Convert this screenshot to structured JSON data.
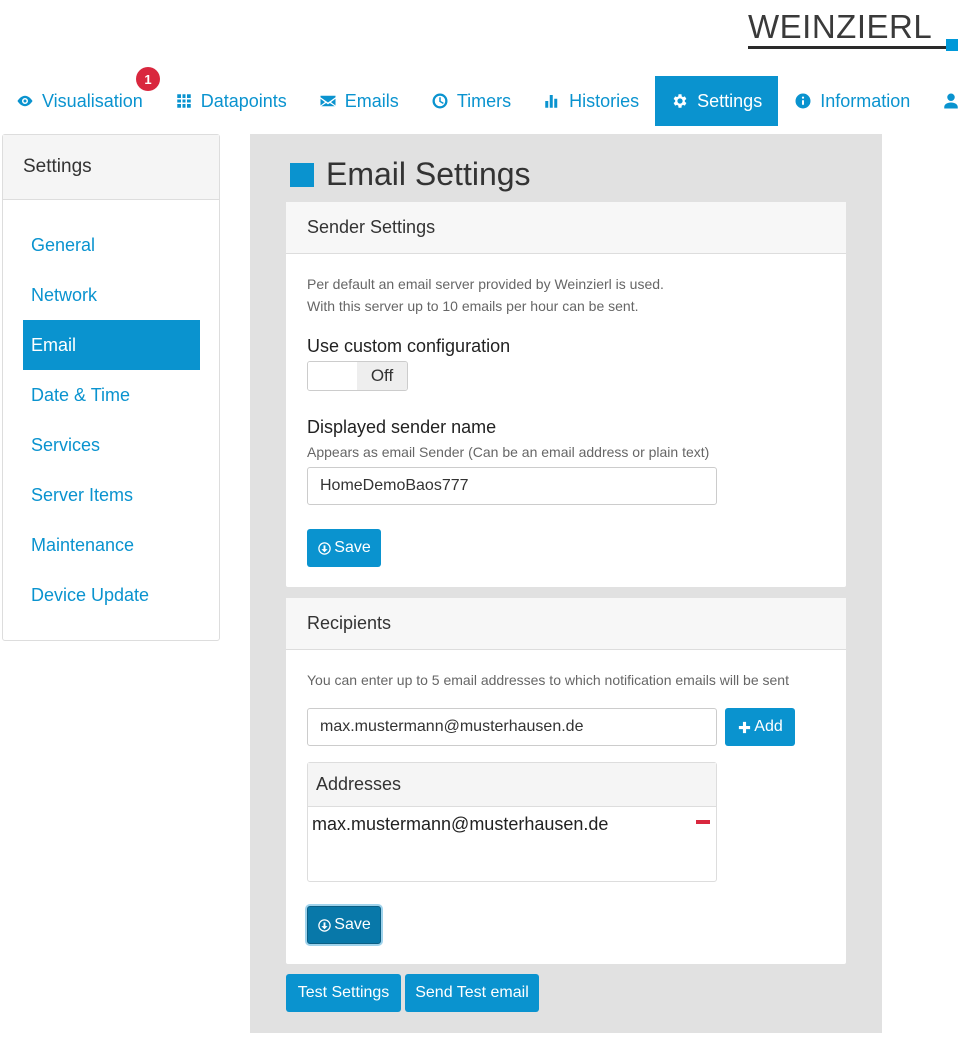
{
  "brand": {
    "logo_text": "WEINZIERL",
    "accent": "#0a93cf"
  },
  "nav": {
    "items": [
      {
        "label": "Visualisation",
        "icon": "eye-icon",
        "badge": "1"
      },
      {
        "label": "Datapoints",
        "icon": "grid-icon"
      },
      {
        "label": "Emails",
        "icon": "envelope-icon"
      },
      {
        "label": "Timers",
        "icon": "clock-icon"
      },
      {
        "label": "Histories",
        "icon": "bar-chart-icon"
      },
      {
        "label": "Settings",
        "icon": "gear-icon",
        "active": true
      },
      {
        "label": "Information",
        "icon": "info-icon"
      }
    ],
    "user_icon": "user-icon"
  },
  "sidebar": {
    "title": "Settings",
    "items": [
      {
        "label": "General"
      },
      {
        "label": "Network"
      },
      {
        "label": "Email",
        "active": true
      },
      {
        "label": "Date & Time"
      },
      {
        "label": "Services"
      },
      {
        "label": "Server Items"
      },
      {
        "label": "Maintenance"
      },
      {
        "label": "Device Update"
      }
    ]
  },
  "main": {
    "title": "Email Settings",
    "sender": {
      "heading": "Sender Settings",
      "info_line1": "Per default an email server provided by Weinzierl is used.",
      "info_line2": "With this server up to 10 emails per hour can be sent.",
      "custom_config_label": "Use custom configuration",
      "custom_config_state": "Off",
      "sender_name_label": "Displayed sender name",
      "sender_name_help": "Appears as email Sender (Can be an email address or plain text)",
      "sender_name_value": "HomeDemoBaos777",
      "save_label": "Save"
    },
    "recipients": {
      "heading": "Recipients",
      "info": "You can enter up to 5 email addresses to which notification emails will be sent",
      "email_input_value": "max.mustermann@musterhausen.de",
      "add_label": "Add",
      "addresses_heading": "Addresses",
      "addresses": [
        "max.mustermann@musterhausen.de"
      ],
      "save_label": "Save"
    },
    "test_settings_label": "Test Settings",
    "send_test_label": "Send Test email"
  }
}
